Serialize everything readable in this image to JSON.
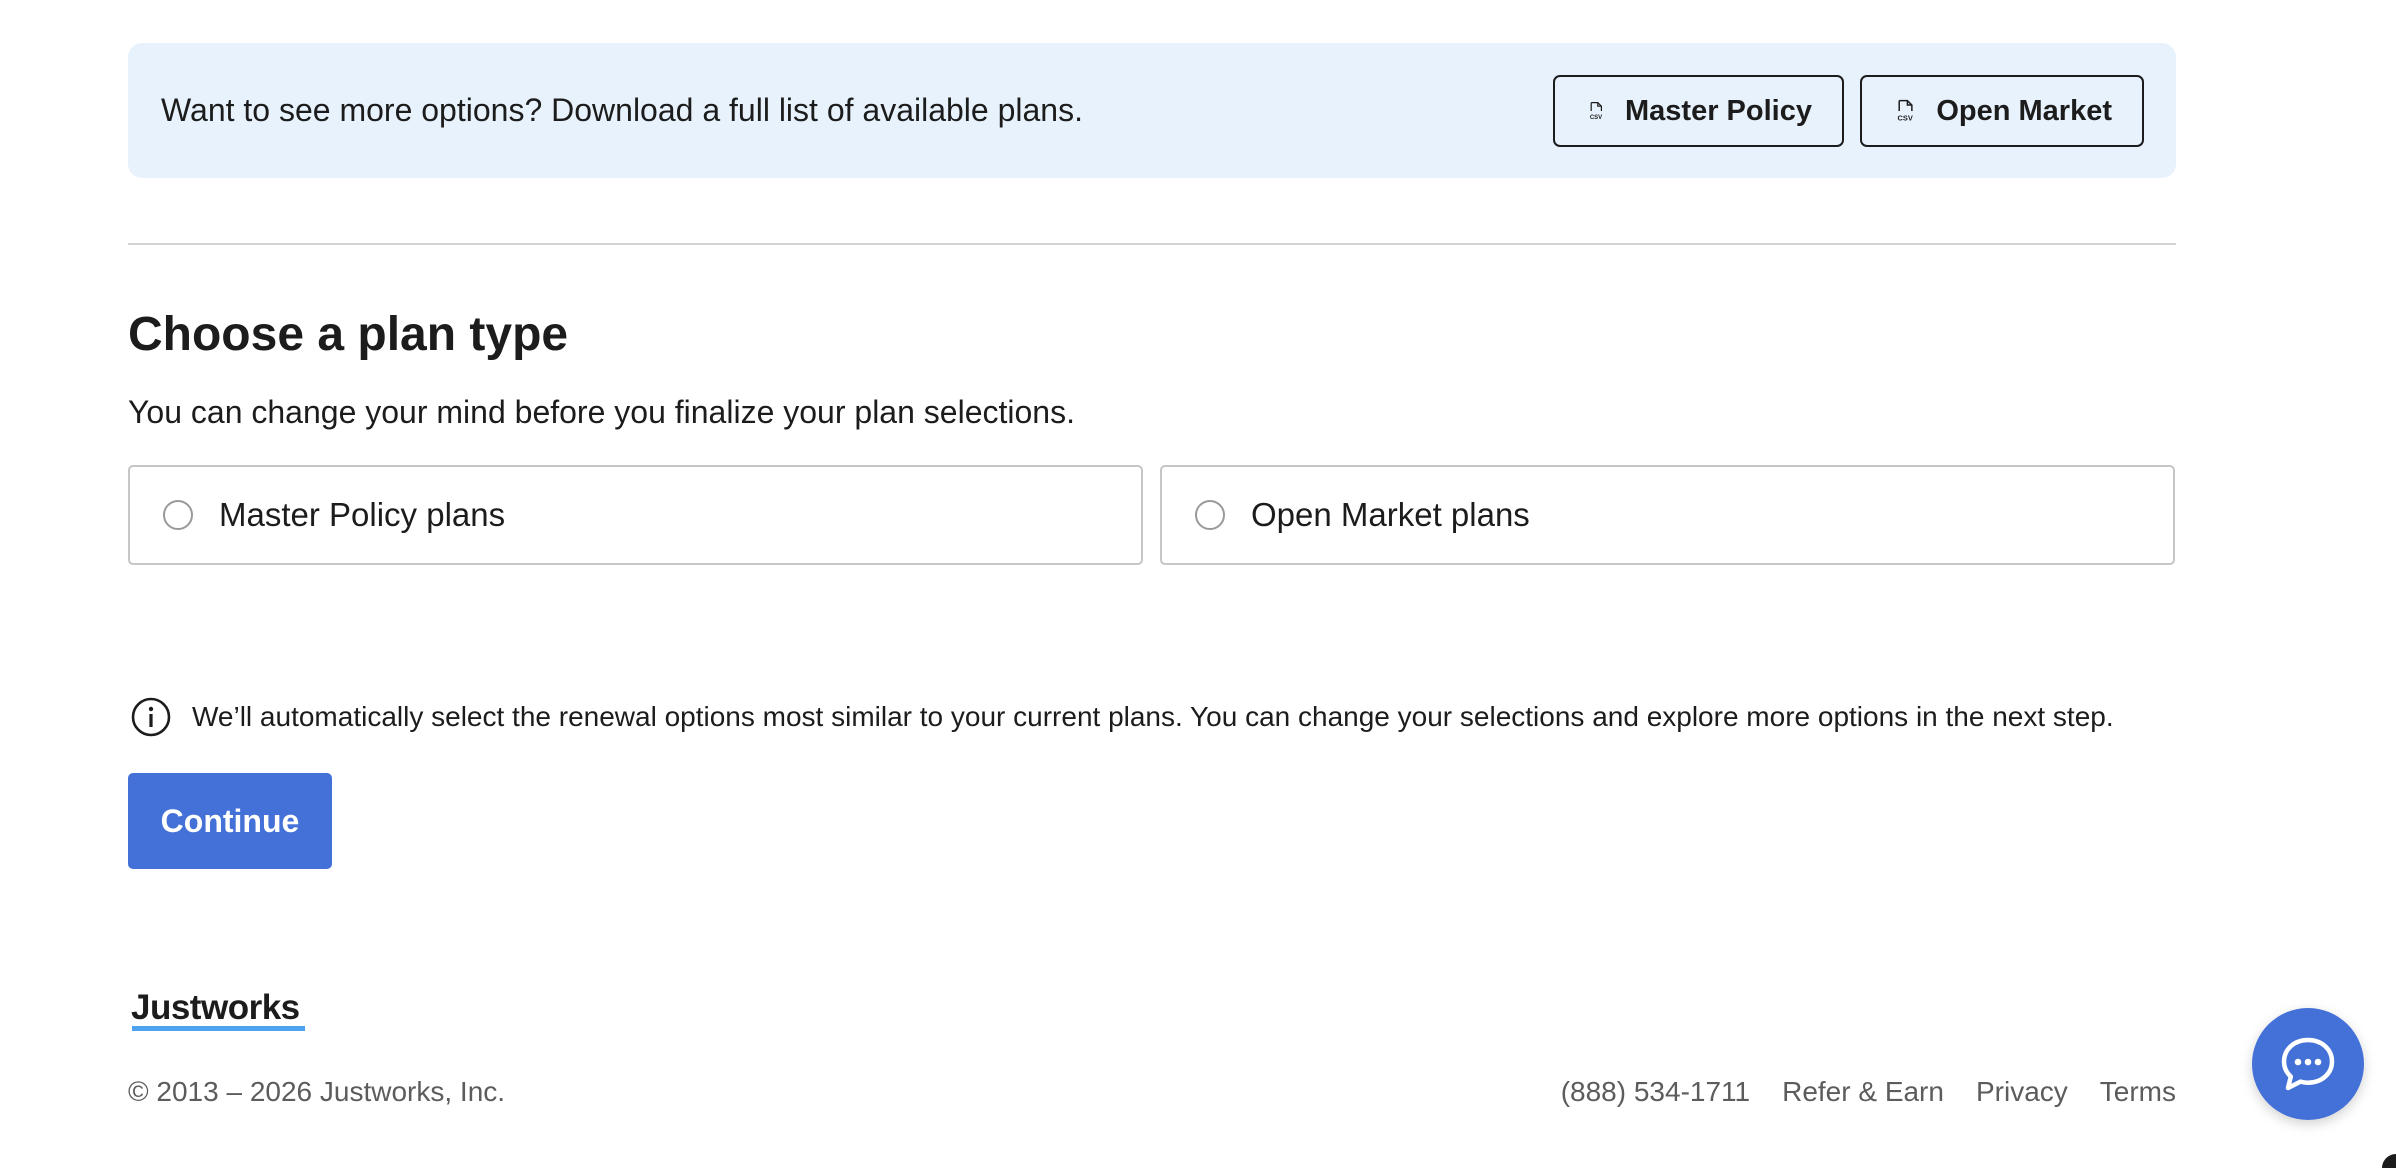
{
  "banner": {
    "text": "Want to see more options? Download a full list of available plans.",
    "buttons": [
      {
        "label": "Master Policy",
        "icon": "csv-file-icon"
      },
      {
        "label": "Open Market",
        "icon": "csv-file-icon"
      }
    ],
    "icon_caption": "CSV",
    "background": "#e8f2fc"
  },
  "plan_section": {
    "title": "Choose a plan type",
    "subtitle": "You can change your mind before you finalize your plan selections.",
    "options": [
      {
        "label": "Master Policy plans",
        "selected": false
      },
      {
        "label": "Open Market plans",
        "selected": false
      }
    ]
  },
  "info_note": {
    "icon": "info-icon",
    "text": "We’ll automatically select the renewal options most similar to your current plans. You can change your selections and explore more options in the next step."
  },
  "continue_button": {
    "label": "Continue",
    "color": "#4471d8"
  },
  "footer": {
    "logo": "Justworks",
    "copyright": "© 2013 – 2026 Justworks, Inc.",
    "links": [
      "(888) 534-1711",
      "Refer & Earn",
      "Privacy",
      "Terms"
    ]
  },
  "chat": {
    "icon": "chat-bubble-icon",
    "color": "#4471d8"
  }
}
